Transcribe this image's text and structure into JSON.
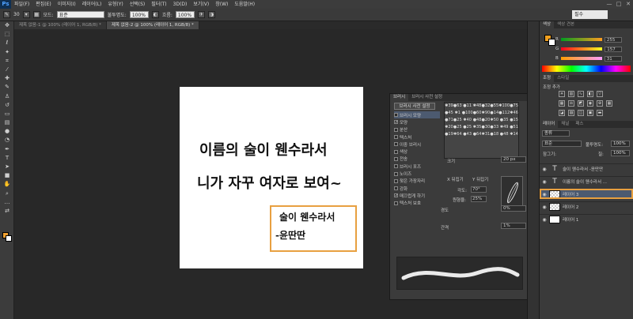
{
  "menubar": {
    "logo": "Ps",
    "items": [
      "파일(F)",
      "편집(E)",
      "이미지(I)",
      "레이어(L)",
      "유형(Y)",
      "선택(S)",
      "필터(T)",
      "3D(D)",
      "보기(V)",
      "창(W)",
      "도움말(H)"
    ],
    "window_buttons": [
      "—",
      "□",
      "✕"
    ]
  },
  "options": {
    "size": "30",
    "mode_label": "모드:",
    "mode_value": "표준",
    "opacity_label": "불투명도:",
    "opacity_value": "100%",
    "flow_label": "흐름:",
    "flow_value": "100%",
    "workspace": "필수"
  },
  "tabs": [
    "제목 없음-1 @ 100% (레이어 1, RGB/8) *",
    "제목 없음-2 @ 100% (레이어 1, RGB/8) *"
  ],
  "canvas": {
    "line1": "이름의 술이 웬수라서",
    "line2": "니가 자꾸 여자로 보여~",
    "stamp_line1": "술이 웬수라서",
    "stamp_line2": "-윤딴딴"
  },
  "brush_panel": {
    "tabs": [
      "브러시",
      "브러시 사전 설정"
    ],
    "preset_button": "브러시 사전 설정",
    "options": [
      {
        "label": "브러시 모양",
        "checked": false,
        "selected": true
      },
      {
        "label": "모양",
        "checked": true,
        "selected": false
      },
      {
        "label": "분산",
        "checked": false,
        "selected": false
      },
      {
        "label": "텍스처",
        "checked": false,
        "selected": false
      },
      {
        "label": "이중 브러시",
        "checked": false,
        "selected": false
      },
      {
        "label": "색상",
        "checked": false,
        "selected": false
      },
      {
        "label": "전송",
        "checked": false,
        "selected": false
      },
      {
        "label": "브러시 포즈",
        "checked": false,
        "selected": false
      },
      {
        "label": "노이즈",
        "checked": false,
        "selected": false
      },
      {
        "label": "젖은 가장자리",
        "checked": false,
        "selected": false
      },
      {
        "label": "강화",
        "checked": false,
        "selected": false
      },
      {
        "label": "매끄럽게 하기",
        "checked": true,
        "selected": false
      },
      {
        "label": "텍스처 보호",
        "checked": false,
        "selected": false
      }
    ],
    "tip_sizes": [
      "39",
      "63",
      "11",
      "48",
      "32",
      "55",
      "100",
      "75",
      "45",
      "1",
      "100",
      "60",
      "90",
      "14",
      "112",
      "46",
      "71",
      "25",
      "40",
      "48",
      "20",
      "50",
      "35",
      "15",
      "20",
      "25",
      "25",
      "35",
      "30",
      "33",
      "49",
      "51",
      "19",
      "64",
      "43",
      "64",
      "31",
      "18",
      "48",
      "14"
    ],
    "size_label": "크기",
    "size_value": "20 px",
    "flip_x": "X 뒤집기",
    "flip_y": "Y 뒤집기",
    "angle_label": "각도:",
    "angle_value": "70°",
    "roundness_label": "원형율:",
    "roundness_value": "25%",
    "hardness_label": "경도",
    "hardness_value": "0%",
    "spacing_label": "간격",
    "spacing_value": "1%"
  },
  "right_panel": {
    "color_tabs": [
      "색상",
      "색상 견본"
    ],
    "r": "255",
    "g": "157",
    "b": "31",
    "adjust_tabs": [
      "조정",
      "스타일"
    ],
    "adjust_title": "조정 추가",
    "layers_tabs": [
      "레이어",
      "채널",
      "패스"
    ],
    "kind": "종류",
    "blend": "표준",
    "opacity_label": "불투명도:",
    "opacity_value": "100%",
    "lock_label": "잠그기:",
    "fill_label": "칠:",
    "fill_value": "100%",
    "layers": [
      {
        "type": "text",
        "name": "술이 웬수라서 -윤딴딴",
        "selected": false
      },
      {
        "type": "text",
        "name": "이름의 술이 웬수라서 ...",
        "selected": false
      },
      {
        "type": "trans",
        "name": "레이어 3",
        "selected": true
      },
      {
        "type": "trans",
        "name": "레이어 2",
        "selected": false
      },
      {
        "type": "white",
        "name": "레이어 1",
        "selected": false
      }
    ]
  },
  "colors": {
    "accent": "#e8a040",
    "foreground": "#ff9d1f",
    "selection": "#4c5a70"
  }
}
